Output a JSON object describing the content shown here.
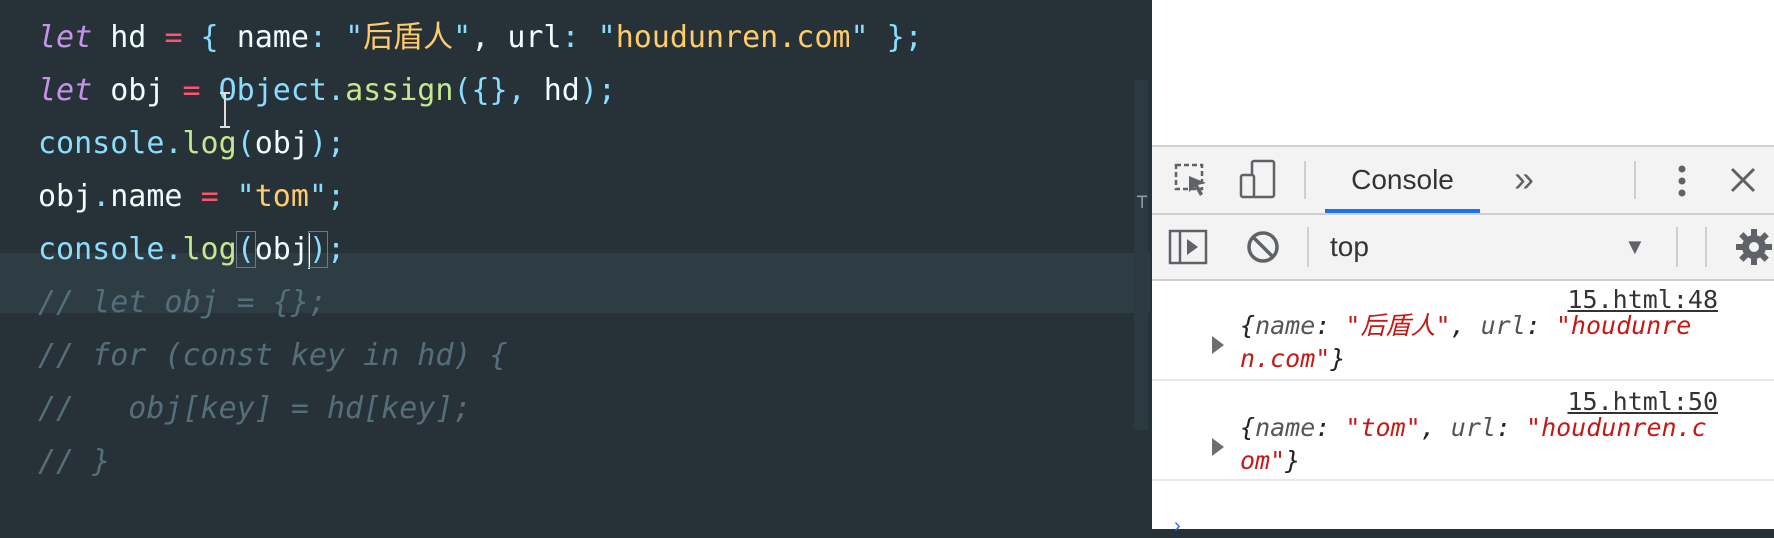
{
  "editor": {
    "lines": [
      {
        "tokens": [
          {
            "t": "let",
            "c": "kw"
          },
          {
            "t": " hd ",
            "c": "plain"
          },
          {
            "t": "=",
            "c": "op"
          },
          {
            "t": " { ",
            "c": "punc"
          },
          {
            "t": "name",
            "c": "plain"
          },
          {
            "t": ": ",
            "c": "punc"
          },
          {
            "t": "\"",
            "c": "punc"
          },
          {
            "t": "后盾人",
            "c": "str2"
          },
          {
            "t": "\"",
            "c": "punc"
          },
          {
            "t": ", ",
            "c": "plain"
          },
          {
            "t": "url",
            "c": "plain"
          },
          {
            "t": ": ",
            "c": "punc"
          },
          {
            "t": "\"",
            "c": "punc"
          },
          {
            "t": "houdunren.com",
            "c": "str2"
          },
          {
            "t": "\"",
            "c": "punc"
          },
          {
            "t": " };",
            "c": "punc"
          }
        ]
      },
      {
        "tokens": [
          {
            "t": "let",
            "c": "kw"
          },
          {
            "t": " obj ",
            "c": "plain"
          },
          {
            "t": "=",
            "c": "op"
          },
          {
            "t": " ",
            "c": "plain"
          },
          {
            "t": "Object",
            "c": "obj-cls"
          },
          {
            "t": ".",
            "c": "punc"
          },
          {
            "t": "assign",
            "c": "prop"
          },
          {
            "t": "({}, ",
            "c": "punc"
          },
          {
            "t": "hd",
            "c": "plain"
          },
          {
            "t": ");",
            "c": "punc"
          }
        ]
      },
      {
        "tokens": [
          {
            "t": "console",
            "c": "obj-cls"
          },
          {
            "t": ".",
            "c": "punc"
          },
          {
            "t": "log",
            "c": "prop"
          },
          {
            "t": "(",
            "c": "punc"
          },
          {
            "t": "obj",
            "c": "plain"
          },
          {
            "t": ");",
            "c": "punc"
          }
        ]
      },
      {
        "tokens": [
          {
            "t": "obj",
            "c": "plain"
          },
          {
            "t": ".",
            "c": "punc"
          },
          {
            "t": "name ",
            "c": "plain"
          },
          {
            "t": "=",
            "c": "op"
          },
          {
            "t": " \"",
            "c": "punc"
          },
          {
            "t": "tom",
            "c": "str2"
          },
          {
            "t": "\";",
            "c": "punc"
          }
        ]
      },
      {
        "tokens": [
          {
            "t": "console",
            "c": "obj-cls"
          },
          {
            "t": ".",
            "c": "punc"
          },
          {
            "t": "log",
            "c": "prop"
          },
          {
            "t": "(",
            "c": "punc brace-box"
          },
          {
            "t": "obj",
            "c": "plain"
          },
          {
            "t": "|caret|",
            "c": "caret"
          },
          {
            "t": ")",
            "c": "punc brace-box"
          },
          {
            "t": ";",
            "c": "punc"
          }
        ]
      },
      {
        "tokens": [
          {
            "t": "// let obj = {};",
            "c": "cmt"
          }
        ]
      },
      {
        "tokens": [
          {
            "t": "// for (const key in hd) {",
            "c": "cmt"
          }
        ]
      },
      {
        "tokens": [
          {
            "t": "//   obj[key] = hd[key];",
            "c": "cmt"
          }
        ]
      },
      {
        "tokens": [
          {
            "t": "// }",
            "c": "cmt"
          }
        ]
      }
    ]
  },
  "devtools": {
    "tab_label": "Console",
    "more_tabs": "»",
    "context": "top",
    "logs": [
      {
        "source": "15.html:48",
        "parts": [
          {
            "t": "{",
            "c": ""
          },
          {
            "t": "name",
            "c": "k"
          },
          {
            "t": ": ",
            "c": ""
          },
          {
            "t": "\"后盾人\"",
            "c": "s"
          },
          {
            "t": ", ",
            "c": ""
          },
          {
            "t": "url",
            "c": "k"
          },
          {
            "t": ": ",
            "c": ""
          },
          {
            "t": "\"houdunren.com\"",
            "c": "s"
          },
          {
            "t": "}",
            "c": ""
          }
        ]
      },
      {
        "source": "15.html:50",
        "parts": [
          {
            "t": "{",
            "c": ""
          },
          {
            "t": "name",
            "c": "k"
          },
          {
            "t": ": ",
            "c": ""
          },
          {
            "t": "\"tom\"",
            "c": "s"
          },
          {
            "t": ", ",
            "c": ""
          },
          {
            "t": "url",
            "c": "k"
          },
          {
            "t": ": ",
            "c": ""
          },
          {
            "t": "\"houdunren.com\"",
            "c": "s"
          },
          {
            "t": "}",
            "c": ""
          }
        ]
      }
    ]
  },
  "icons": {
    "inspect": "inspect-element-icon",
    "device": "device-toolbar-icon",
    "kebab": "more-options-icon",
    "close": "close-icon",
    "sidebar": "console-sidebar-icon",
    "clear": "clear-console-icon",
    "settings": "gear-icon"
  }
}
